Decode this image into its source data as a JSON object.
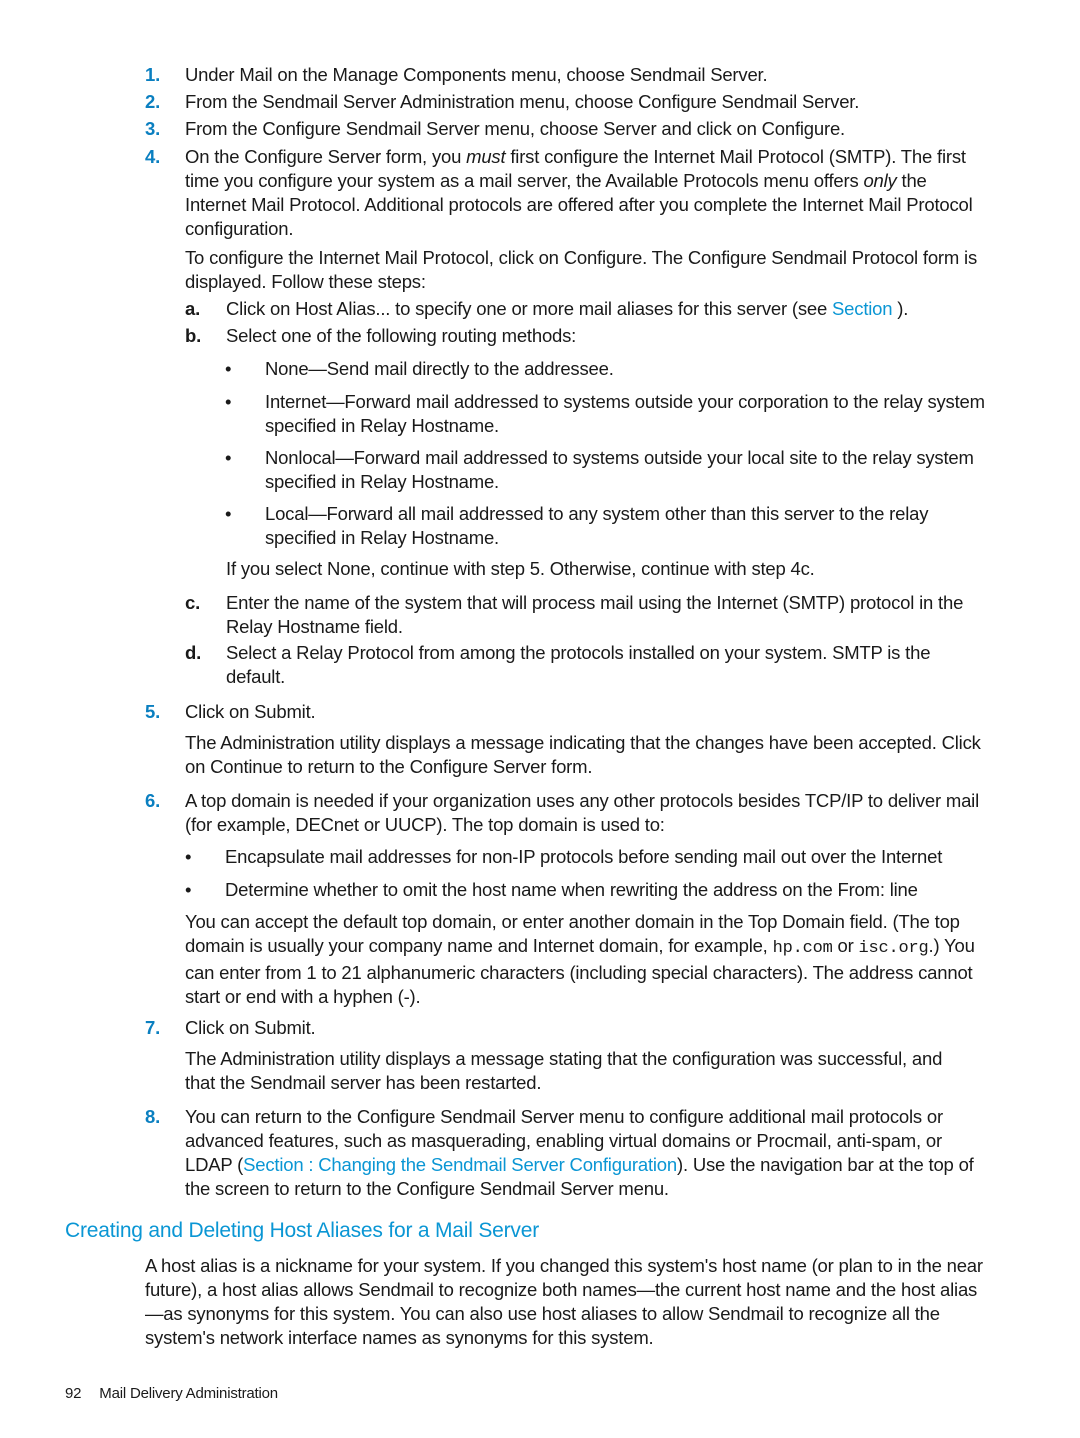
{
  "steps": [
    {
      "num": "1.",
      "text": "Under Mail on the Manage Components menu, choose Sendmail Server."
    },
    {
      "num": "2.",
      "text": "From the Sendmail Server Administration menu, choose Configure Sendmail Server."
    },
    {
      "num": "3.",
      "text": "From the Configure Sendmail Server menu, choose Server and click on Configure."
    },
    {
      "num": "4.",
      "text_a": "On the Configure Server form, you ",
      "em_1": "must",
      "text_b": " first configure the Internet Mail Protocol (SMTP). The first time you configure your system as a mail server, the Available Protocols menu offers ",
      "em_2": "only",
      "text_c": " the Internet Mail Protocol. Additional protocols are offered after you complete the Internet Mail Protocol configuration.",
      "para": "To configure the Internet Mail Protocol, click on Configure. The Configure Sendmail Protocol form is displayed. Follow these steps:",
      "substeps": [
        {
          "label": "a.",
          "text_a": "Click on Host Alias... to specify one or more mail aliases for this server (see ",
          "link": "Section",
          "text_b": " )."
        },
        {
          "label": "b.",
          "text": "Select one of the following routing methods:"
        },
        {
          "label": "c.",
          "text": "Enter the name of the system that will process mail using the Internet (SMTP) protocol in the Relay Hostname field."
        },
        {
          "label": "d.",
          "text": "Select a Relay Protocol from among the protocols installed on your system. SMTP is the default."
        }
      ],
      "routing_bullets": [
        "None—Send mail directly to the addressee.",
        "Internet—Forward mail addressed to systems outside your corporation to the relay system specified in Relay Hostname.",
        "Nonlocal—Forward mail addressed to systems outside your local site to the relay system specified in Relay Hostname.",
        "Local—Forward all mail addressed to any system other than this server to the relay specified in Relay Hostname."
      ],
      "routing_note": "If you select None, continue with step 5. Otherwise, continue with step 4c."
    },
    {
      "num": "5.",
      "text": "Click on Submit.",
      "para": "The Administration utility displays a message indicating that the changes have been accepted. Click on Continue to return to the Configure Server form."
    },
    {
      "num": "6.",
      "text": "A top domain is needed if your organization uses any other protocols besides TCP/IP to deliver mail (for example, DECnet or UUCP). The top domain is used to:",
      "bullets": [
        "Encapsulate mail addresses for non-IP protocols before sending mail out over the Internet",
        "Determine whether to omit the host name when rewriting the address on the From: line"
      ],
      "para_a": "You can accept the default top domain, or enter another domain in the Top Domain field. (The top domain is usually your company name and Internet domain, for example, ",
      "code_1": "hp.com",
      "para_b": " or ",
      "code_2": "isc.org",
      "para_c": ".) You can enter from 1 to 21 alphanumeric characters (including special characters). The address cannot start or end with a hyphen (-)."
    },
    {
      "num": "7.",
      "text": "Click on Submit.",
      "para": "The Administration utility displays a message stating that the configuration was successful, and that the Sendmail server has been restarted."
    },
    {
      "num": "8.",
      "text_a": "You can return to the Configure Sendmail Server menu to configure additional mail protocols or advanced features, such as masquerading, enabling virtual domains or Procmail, anti-spam, or LDAP (",
      "link": "Section : Changing the Sendmail Server Configuration",
      "text_b": "). Use the navigation bar at the top of the screen to return to the Configure Sendmail Server menu."
    }
  ],
  "section": {
    "heading": "Creating and Deleting Host Aliases for a Mail Server",
    "body": "A host alias is a nickname for your system. If you changed this system's host name (or plan to in the near future), a host alias allows Sendmail to recognize both names—the current host name and the host alias—as synonyms for this system. You can also use host aliases to allow Sendmail to recognize all the system's network interface names as synonyms for this system."
  },
  "footer": {
    "page_number": "92",
    "title": "Mail Delivery Administration"
  },
  "colors": {
    "accent": "#0a96d4",
    "step_number": "#0a7fc0",
    "text": "#1a1a1a"
  }
}
